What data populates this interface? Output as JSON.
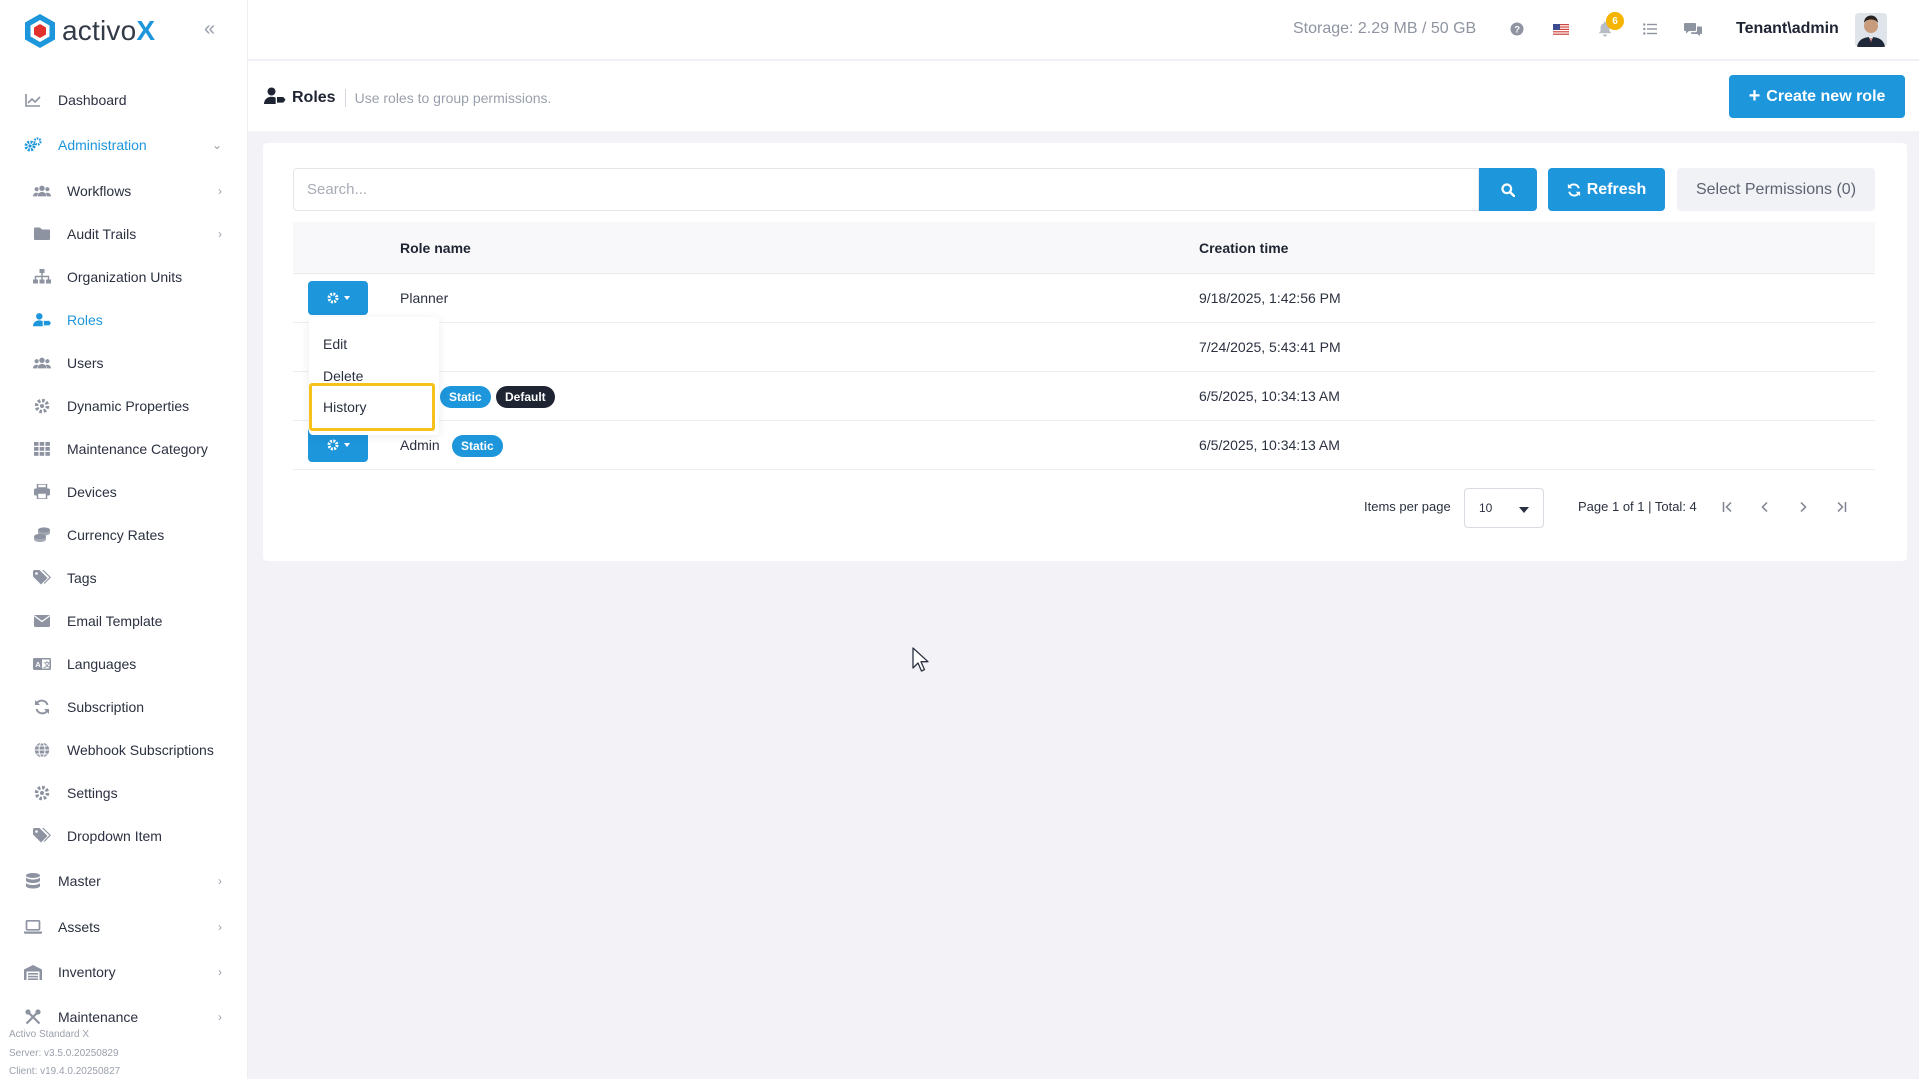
{
  "brand": {
    "name_part1": "activo",
    "name_part2": "X",
    "accent": "#1e96dc"
  },
  "sidebar": {
    "items": [
      {
        "label": "Dashboard",
        "icon": "chart-line-icon"
      },
      {
        "label": "Administration",
        "icon": "cogs-icon",
        "expanded": true
      },
      {
        "label": "Workflows",
        "icon": "users-group-icon"
      },
      {
        "label": "Audit Trails",
        "icon": "folder-icon"
      },
      {
        "label": "Organization Units",
        "icon": "sitemap-icon"
      },
      {
        "label": "Roles",
        "icon": "user-tag-icon",
        "active": true
      },
      {
        "label": "Users",
        "icon": "users-icon"
      },
      {
        "label": "Dynamic Properties",
        "icon": "gear-icon"
      },
      {
        "label": "Maintenance Category",
        "icon": "grid-icon"
      },
      {
        "label": "Devices",
        "icon": "printer-icon"
      },
      {
        "label": "Currency Rates",
        "icon": "coins-icon"
      },
      {
        "label": "Tags",
        "icon": "tags-icon"
      },
      {
        "label": "Email Template",
        "icon": "envelope-icon"
      },
      {
        "label": "Languages",
        "icon": "language-icon"
      },
      {
        "label": "Subscription",
        "icon": "sync-icon"
      },
      {
        "label": "Webhook Subscriptions",
        "icon": "globe-icon"
      },
      {
        "label": "Settings",
        "icon": "gear-icon"
      },
      {
        "label": "Dropdown Item",
        "icon": "tags-icon"
      },
      {
        "label": "Master",
        "icon": "database-icon"
      },
      {
        "label": "Assets",
        "icon": "laptop-icon"
      },
      {
        "label": "Inventory",
        "icon": "warehouse-icon"
      },
      {
        "label": "Maintenance",
        "icon": "tools-icon"
      }
    ],
    "footer": {
      "product": "Activo Standard X",
      "server": "Server: v3.5.0.20250829",
      "client": "Client: v19.4.0.20250827"
    }
  },
  "topbar": {
    "storage": "Storage: 2.29 MB / 50 GB",
    "notifications_count": "6",
    "user": "Tenant\\admin"
  },
  "subheader": {
    "title": "Roles",
    "subtitle": "Use roles to group permissions.",
    "create_button": "Create new role"
  },
  "toolbar": {
    "search_placeholder": "Search...",
    "refresh": "Refresh",
    "select_permissions": "Select Permissions (0)"
  },
  "table": {
    "headers": {
      "role_name": "Role name",
      "creation_time": "Creation time"
    },
    "rows": [
      {
        "name": "Planner",
        "created": "9/18/2025, 1:42:56 PM"
      },
      {
        "name": "",
        "created": "7/24/2025, 5:43:41 PM"
      },
      {
        "name": "",
        "created": "6/5/2025, 10:34:13 AM",
        "badges": [
          "Static",
          "Default"
        ]
      },
      {
        "name": "Admin",
        "created": "6/5/2025, 10:34:13 AM",
        "badges": [
          "Static"
        ]
      }
    ]
  },
  "actions_menu": {
    "edit": "Edit",
    "delete": "Delete",
    "history": "History"
  },
  "pagination": {
    "items_per_page_label": "Items per page",
    "items_per_page_value": "10",
    "page_info": "Page 1 of 1 | Total: 4"
  }
}
